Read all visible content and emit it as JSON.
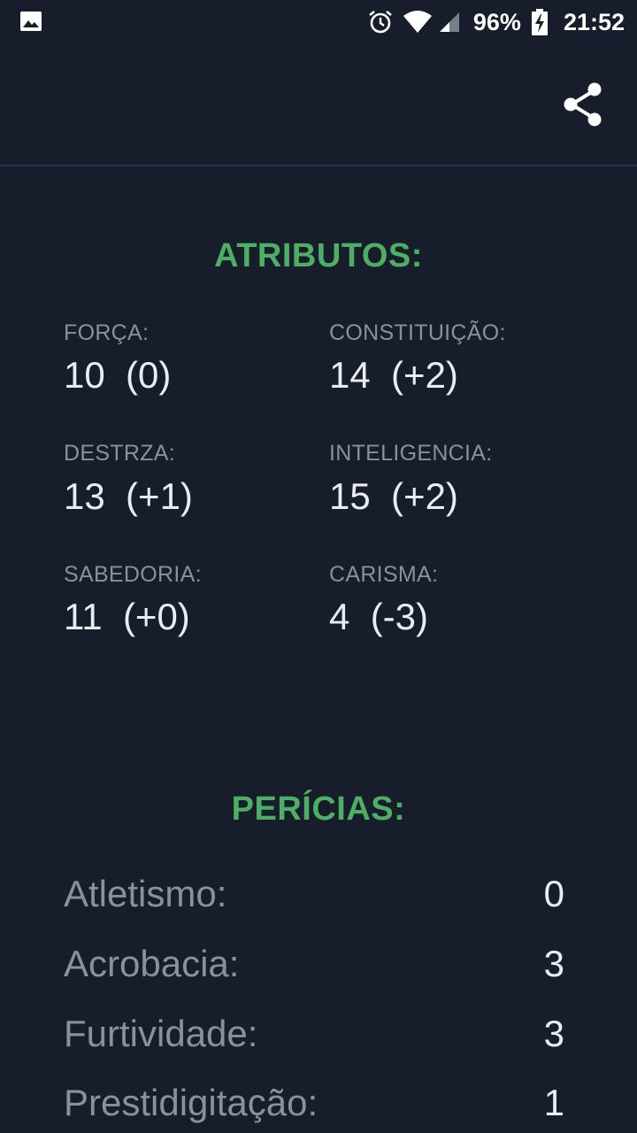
{
  "status_bar": {
    "battery": "96%",
    "time": "21:52"
  },
  "atributos": {
    "title": "ATRIBUTOS:",
    "items": [
      {
        "label": "FORÇA:",
        "value": "10  (0)"
      },
      {
        "label": "CONSTITUIÇÃO:",
        "value": "14  (+2)"
      },
      {
        "label": "DESTRZA:",
        "value": "13  (+1)"
      },
      {
        "label": "INTELIGENCIA:",
        "value": "15  (+2)"
      },
      {
        "label": "SABEDORIA:",
        "value": "11  (+0)"
      },
      {
        "label": "CARISMA:",
        "value": "4  (-3)"
      }
    ]
  },
  "pericias": {
    "title": "PERÍCIAS:",
    "items": [
      {
        "name": "Atletismo:",
        "value": "0"
      },
      {
        "name": "Acrobacia:",
        "value": "3"
      },
      {
        "name": "Furtividade:",
        "value": "3"
      },
      {
        "name": "Prestidigitação:",
        "value": "1"
      }
    ]
  },
  "colors": {
    "background": "#181d2b",
    "accent": "#4caf63",
    "label": "#8b909a",
    "value": "#e9ecf1"
  },
  "icons": {
    "gallery": "image-icon",
    "alarm": "alarm-icon",
    "wifi": "wifi-icon",
    "signal": "signal-icon",
    "battery": "battery-charging-icon",
    "share": "share-icon"
  }
}
